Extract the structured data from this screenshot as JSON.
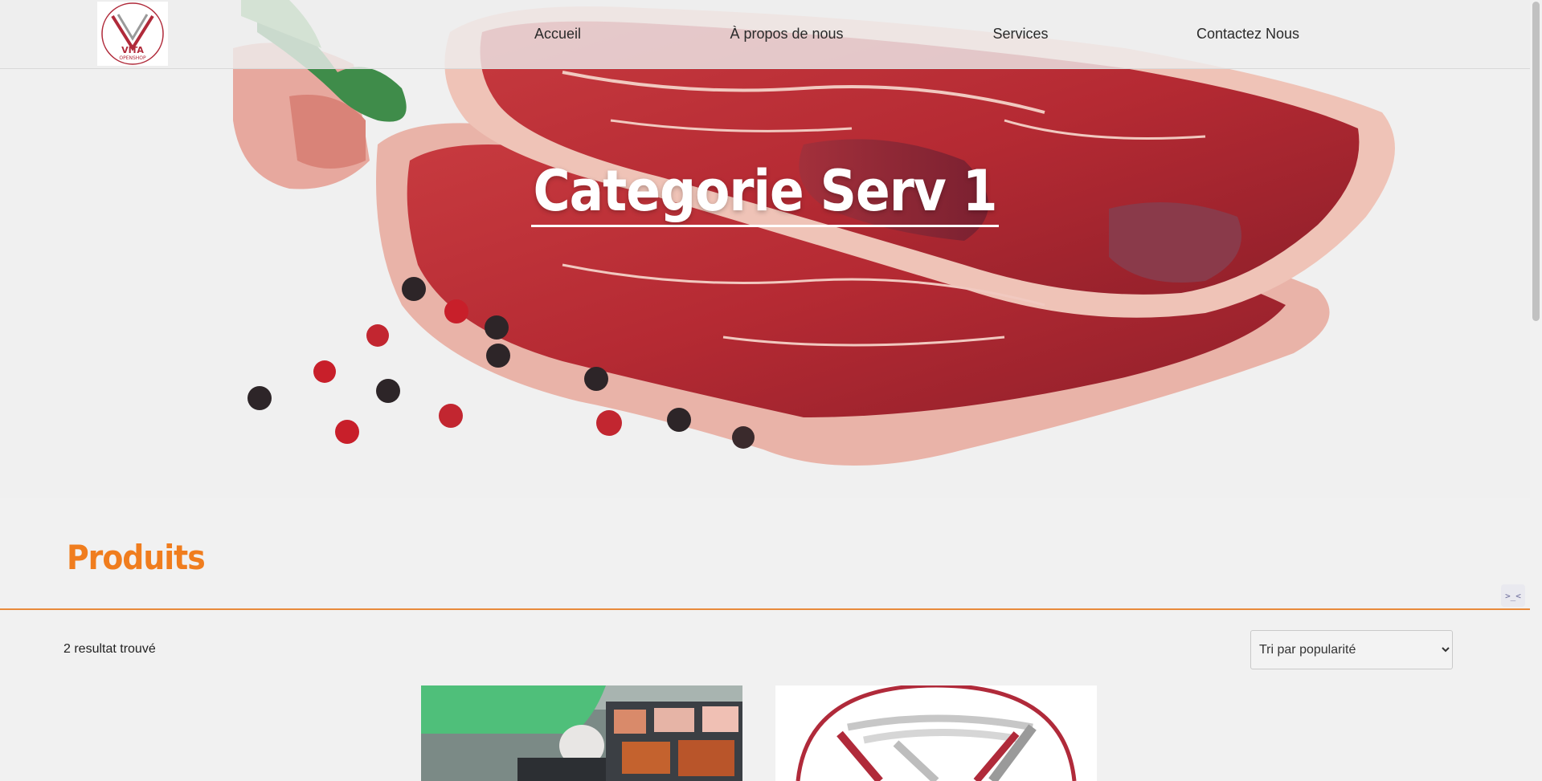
{
  "brand": {
    "logo_text": "VITA",
    "logo_subtext": "OPENSHOP"
  },
  "nav": {
    "items": [
      {
        "label": "Accueil"
      },
      {
        "label": "À propos de nous"
      },
      {
        "label": "Services"
      },
      {
        "label": "Contactez Nous"
      }
    ]
  },
  "hero": {
    "title": "Categorie Serv 1",
    "image": "raw-beef-steak-with-peppercorns"
  },
  "products": {
    "title": "Produits",
    "result_count": "2 resultat trouvé",
    "sort": {
      "selected": "Tri par popularité"
    },
    "cards": [
      {
        "image": "butcher-display-case"
      },
      {
        "image": "vita-openshop-logo"
      }
    ]
  },
  "widget": {
    "label": ">_<"
  },
  "colors": {
    "accent": "#f07d1e",
    "rule": "#e88a3b",
    "logo_red": "#b02a3a"
  }
}
